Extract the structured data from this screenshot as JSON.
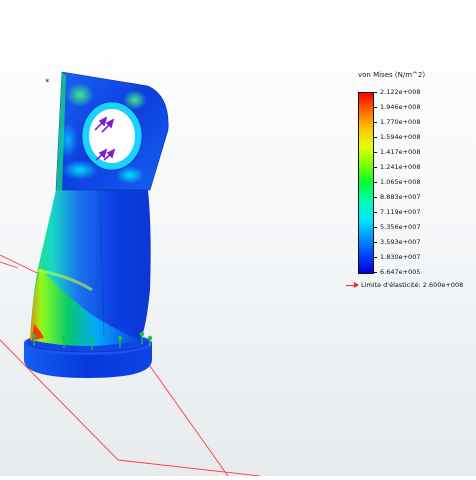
{
  "legend": {
    "title": "von Mises (N/m^2)",
    "ticks": [
      "2.122e+008",
      "1.946e+008",
      "1.770e+008",
      "1.594e+008",
      "1.417e+008",
      "1.241e+008",
      "1.065e+008",
      "8.883e+007",
      "7.119e+007",
      "5.356e+007",
      "3.593e+007",
      "1.830e+007",
      "6.647e+005"
    ],
    "yield_label": "Limite d'élasticité: 2.600e+008",
    "max_color": "#ff0000",
    "min_color": "#0000d8",
    "yield_color": "#ff2020"
  },
  "viewport": {
    "origin_marker": "*"
  }
}
